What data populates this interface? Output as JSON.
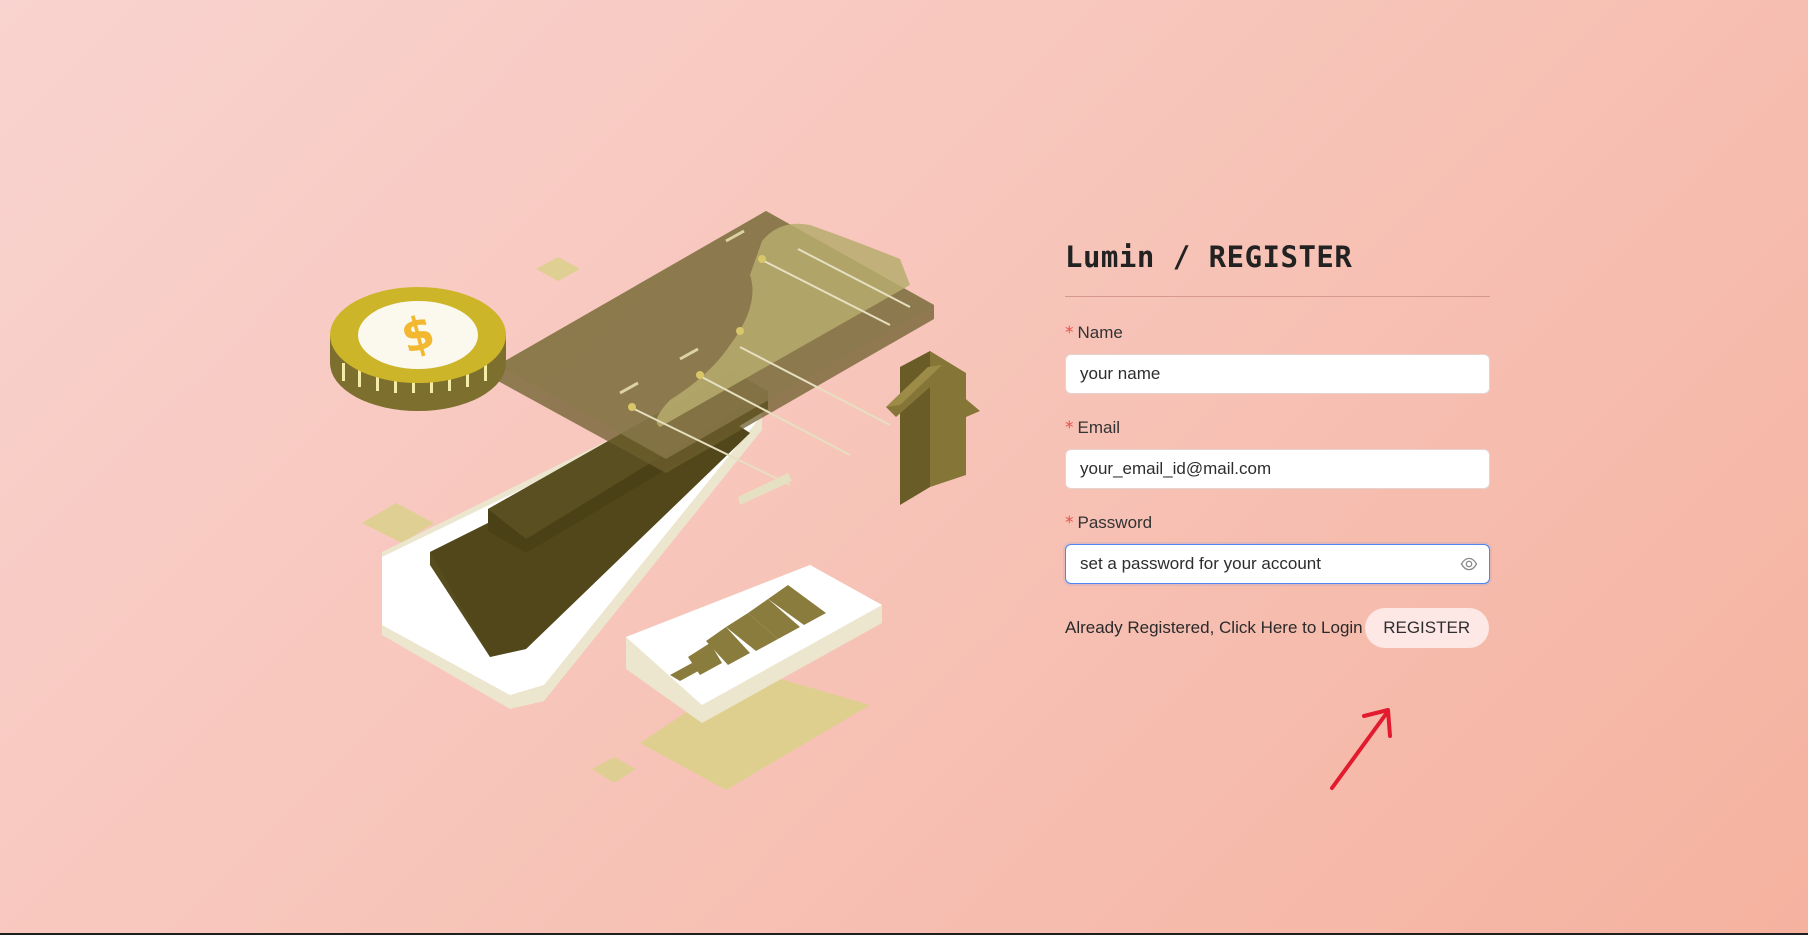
{
  "page": {
    "title": "Lumin / REGISTER"
  },
  "form": {
    "required_mark": "*",
    "name": {
      "label": "Name",
      "placeholder": "your name"
    },
    "email": {
      "label": "Email",
      "placeholder": "your_email_id@mail.com"
    },
    "password": {
      "label": "Password",
      "placeholder": "set a password for your account",
      "toggle_icon": "eye-icon"
    },
    "login_link": "Already Registered, Click Here to Login",
    "register_button": "REGISTER"
  },
  "illustration": {
    "subject": "finance-growth-illustration",
    "icons": [
      "dollar-coin-icon",
      "smartphone-icon",
      "up-arrow-icon",
      "bar-chart-card-icon",
      "line-chart-panel-icon"
    ]
  },
  "annotation": {
    "icon": "red-arrow-annotation",
    "color": "#e21b2f"
  },
  "colors": {
    "background_start": "#f9d3cf",
    "background_end": "#f5b29f",
    "required": "#e7504a",
    "focus_border": "#4d86f2",
    "button_bg": "#fde8e6",
    "olive": "#8a7c3d",
    "olive_dark": "#4e4418",
    "gold": "#cdb52a"
  }
}
